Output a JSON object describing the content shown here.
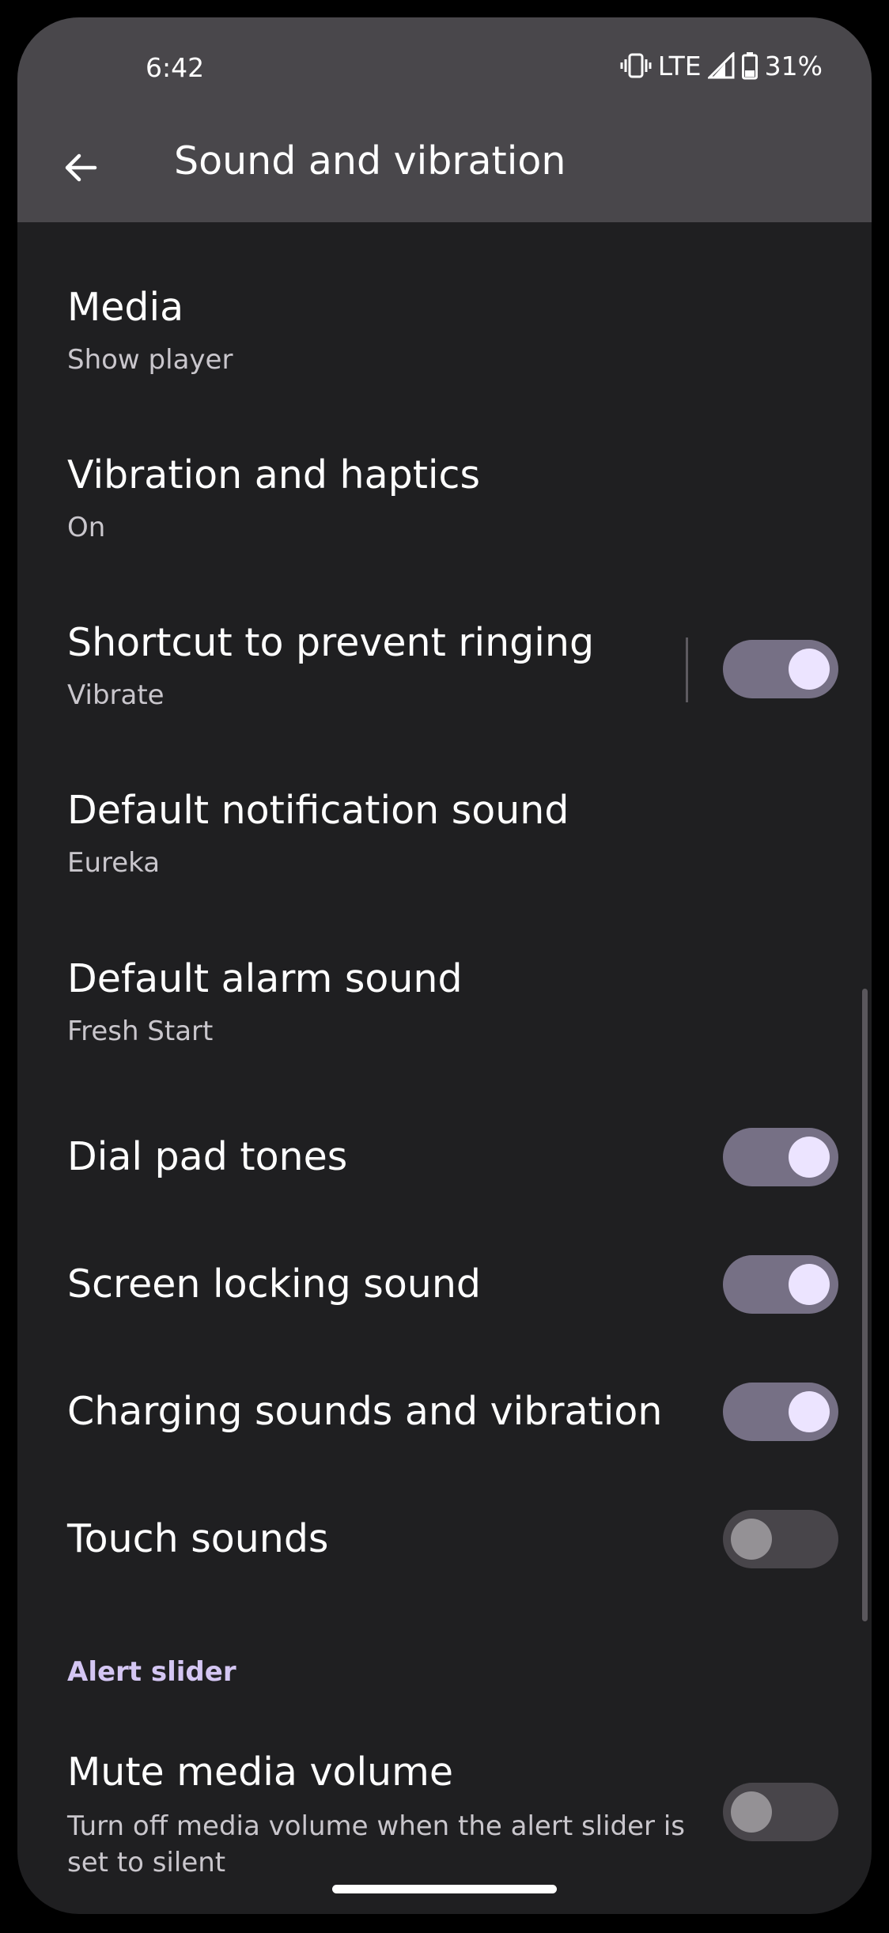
{
  "status_bar": {
    "time": "6:42",
    "network": "LTE",
    "battery": "31%"
  },
  "header": {
    "title": "Sound and vibration"
  },
  "items": [
    {
      "title": "Media",
      "subtitle": "Show player"
    },
    {
      "title": "Vibration and haptics",
      "subtitle": "On"
    },
    {
      "title": "Shortcut to prevent ringing",
      "subtitle": "Vibrate",
      "toggle": "on"
    },
    {
      "title": "Default notification sound",
      "subtitle": "Eureka"
    },
    {
      "title": "Default alarm sound",
      "subtitle": "Fresh Start"
    },
    {
      "title": "Dial pad tones",
      "toggle": "on"
    },
    {
      "title": "Screen locking sound",
      "toggle": "on"
    },
    {
      "title": "Charging sounds and vibration",
      "toggle": "on"
    },
    {
      "title": "Touch sounds",
      "toggle": "off"
    }
  ],
  "alert_slider": {
    "header": "Alert slider",
    "mute_media": {
      "title": "Mute media volume",
      "subtitle": "Turn off media volume when the alert slider is set to silent",
      "toggle": "off"
    }
  },
  "colors": {
    "background": "#1f1f21",
    "app_bar": "#49474b",
    "toggle_on_track": "#767085",
    "toggle_on_knob": "#ece4ff",
    "toggle_off_track": "#48454a",
    "accent": "#d4c6f3"
  }
}
